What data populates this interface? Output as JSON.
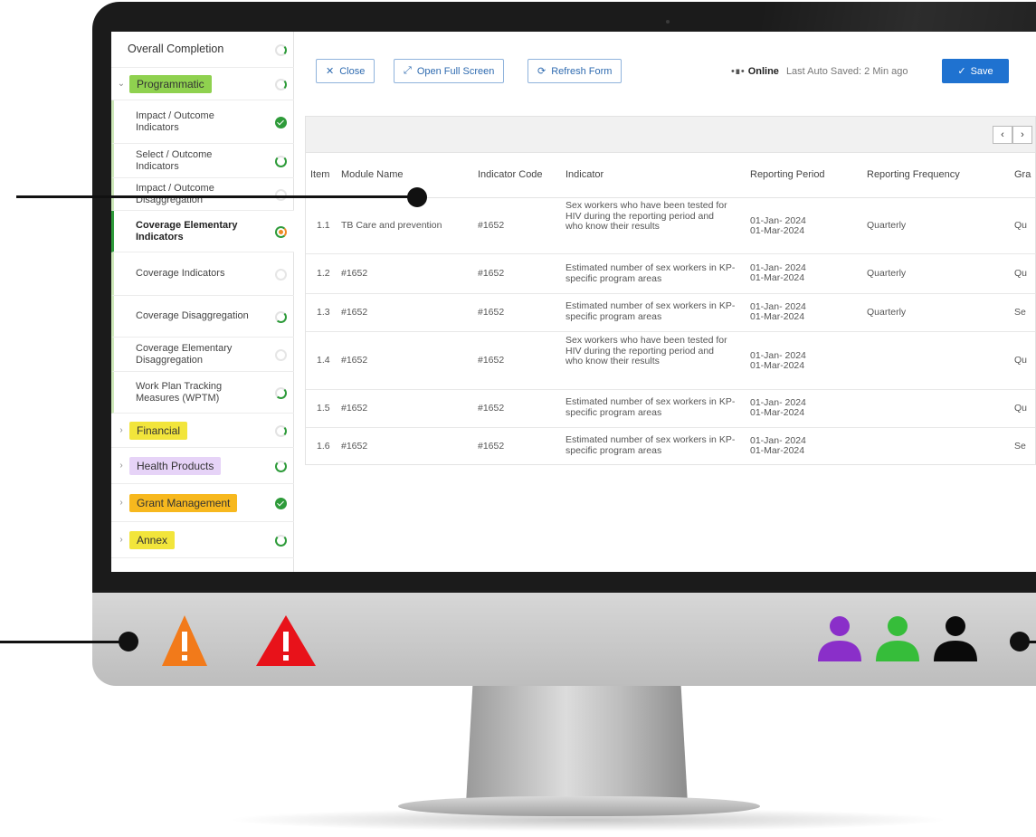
{
  "sidebar": {
    "overall_label": "Overall Completion",
    "items": [
      {
        "label": "Programmatic",
        "color": "#8fd14f"
      },
      {
        "label": "Impact / Outcome Indicators"
      },
      {
        "label": "Select / Outcome Indicators"
      },
      {
        "label": "Impact / Outcome Disaggregation"
      },
      {
        "label": "Coverage Elementary Indicators"
      },
      {
        "label": "Coverage Indicators"
      },
      {
        "label": "Coverage Disaggregation"
      },
      {
        "label": "Coverage Elementary Disaggregation"
      },
      {
        "label": "Work Plan Tracking Measures (WPTM)"
      },
      {
        "label": "Financial",
        "color": "#f2e53b"
      },
      {
        "label": "Health Products",
        "color": "#e6d3f7"
      },
      {
        "label": "Grant Management",
        "color": "#f7b81e"
      },
      {
        "label": "Annex",
        "color": "#f2e53b"
      }
    ]
  },
  "toolbar": {
    "close_label": "Close",
    "fullscreen_label": "Open Full Screen",
    "refresh_label": "Refresh Form",
    "online_label": "Online",
    "autosave_text": "Last Auto Saved: 2 Min ago",
    "save_label": "Save"
  },
  "table": {
    "columns": [
      "Item",
      "Module Name",
      "Indicator Code",
      "Indicator",
      "Reporting Period",
      "Reporting Frequency",
      "Gra"
    ],
    "rows": [
      {
        "item": "1.1",
        "module": "TB Care and prevention",
        "code": "#1652",
        "indicator": "Sex workers who have been tested for HIV during the reporting period and who know their results",
        "period_start": "01-Jan- 2024",
        "period_end": "01-Mar-2024",
        "frequency": "Quarterly",
        "gra": "Qu"
      },
      {
        "item": "1.2",
        "module": "#1652",
        "code": "#1652",
        "indicator": "Estimated number of sex workers in KP-specific program areas",
        "period_start": "01-Jan- 2024",
        "period_end": "01-Mar-2024",
        "frequency": "Quarterly",
        "gra": "Qu"
      },
      {
        "item": "1.3",
        "module": "#1652",
        "code": "#1652",
        "indicator": "Estimated number of sex workers in KP-specific program areas",
        "period_start": "01-Jan- 2024",
        "period_end": "01-Mar-2024",
        "frequency": "Quarterly",
        "gra": "Se"
      },
      {
        "item": "1.4",
        "module": "#1652",
        "code": "#1652",
        "indicator": "Sex workers who have been tested for HIV during the reporting period and who know their results",
        "period_start": "01-Jan- 2024",
        "period_end": "01-Mar-2024",
        "frequency": "",
        "gra": "Qu"
      },
      {
        "item": "1.5",
        "module": "#1652",
        "code": "#1652",
        "indicator": "Estimated number of sex workers in KP-specific program areas",
        "period_start": "01-Jan- 2024",
        "period_end": "01-Mar-2024",
        "frequency": "",
        "gra": "Qu"
      },
      {
        "item": "1.6",
        "module": "#1652",
        "code": "#1652",
        "indicator": "Estimated number of sex workers in KP-specific program areas",
        "period_start": "01-Jan- 2024",
        "period_end": "01-Mar-2024",
        "frequency": "",
        "gra": "Se"
      }
    ]
  },
  "alerts": [
    {
      "name": "warning-icon",
      "color": "#f27a1a"
    },
    {
      "name": "error-icon",
      "color": "#e8121a"
    }
  ],
  "users": [
    {
      "name": "user-icon",
      "color": "#8a2fc9"
    },
    {
      "name": "user-icon",
      "color": "#36bd3a"
    },
    {
      "name": "user-icon",
      "color": "#0a0a0a"
    }
  ]
}
